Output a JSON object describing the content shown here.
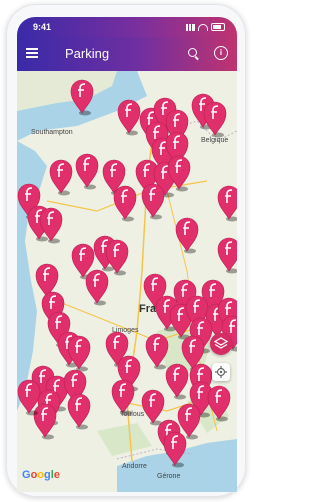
{
  "status_bar": {
    "time": "9:41"
  },
  "app_bar": {
    "title": "Parking",
    "menu_icon": "hamburger-icon",
    "search_icon": "search-icon",
    "info_icon": "info-icon",
    "info_glyph": "i"
  },
  "map": {
    "labels": [
      "Southampton",
      "Belgique",
      "Limoges",
      "Fra",
      "Toulous",
      "Andorre",
      "Gérone"
    ],
    "attribution": [
      "G",
      "o",
      "o",
      "g",
      "l",
      "e"
    ],
    "brand_colors": {
      "pin": "#e12f6b",
      "header_start": "#3a2aa8",
      "header_end": "#c0336f"
    },
    "layers_button_icon": "layers-icon",
    "location_button_icon": "crosshair-icon"
  }
}
